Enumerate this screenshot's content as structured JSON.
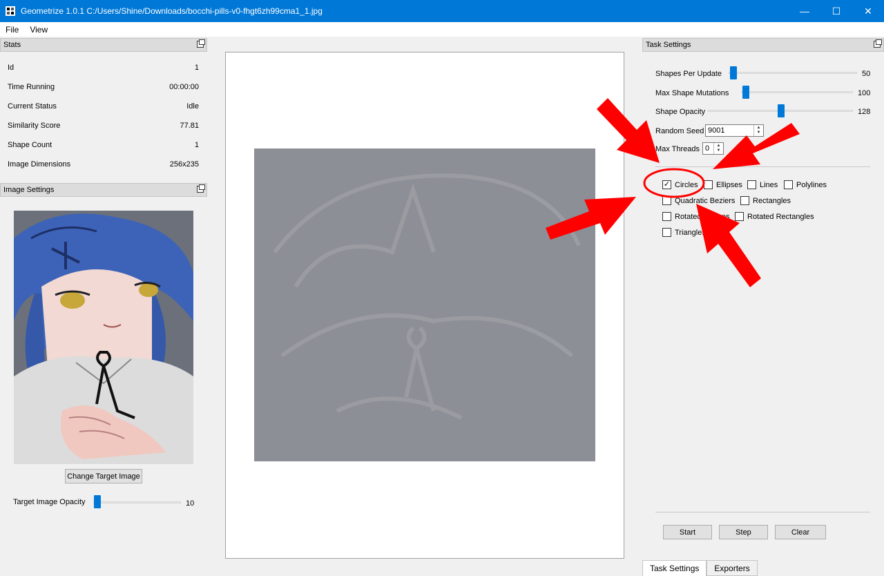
{
  "window": {
    "title": "Geometrize 1.0.1 C:/Users/Shine/Downloads/bocchi-pills-v0-fhgt6zh99cma1_1.jpg",
    "min_glyph": "—",
    "max_glyph": "☐",
    "close_glyph": "✕"
  },
  "menu": {
    "file": "File",
    "view": "View"
  },
  "stats": {
    "header": "Stats",
    "rows": [
      {
        "label": "Id",
        "value": "1"
      },
      {
        "label": "Time Running",
        "value": "00:00:00"
      },
      {
        "label": "Current Status",
        "value": "Idle"
      },
      {
        "label": "Similarity Score",
        "value": "77.81"
      },
      {
        "label": "Shape Count",
        "value": "1"
      },
      {
        "label": "Image Dimensions",
        "value": "256x235"
      }
    ]
  },
  "image_settings": {
    "header": "Image Settings",
    "change_button": "Change Target Image",
    "opacity_label": "Target Image Opacity",
    "opacity_value": "10"
  },
  "task_settings": {
    "header": "Task Settings",
    "sliders": [
      {
        "label": "Shapes Per Update",
        "value": "50"
      },
      {
        "label": "Max Shape Mutations",
        "value": "100"
      },
      {
        "label": "Shape Opacity",
        "value": "128"
      }
    ],
    "random_seed_label": "Random Seed",
    "random_seed_value": "9001",
    "max_threads_label": "Max Threads",
    "max_threads_value": "0",
    "shapes": {
      "circles": "Circles",
      "ellipses": "Ellipses",
      "lines": "Lines",
      "polylines": "Polylines",
      "quadratic_beziers": "Quadratic Beziers",
      "rectangles": "Rectangles",
      "rotated_ellipses": "Rotated Ellipses",
      "rotated_rectangles": "Rotated Rectangles",
      "triangles": "Triangles"
    },
    "checked": [
      "circles"
    ],
    "start": "Start",
    "step": "Step",
    "clear": "Clear"
  },
  "tabs": {
    "task_settings": "Task Settings",
    "exporters": "Exporters"
  },
  "colors": {
    "titlebar": "#0078d7",
    "accent": "#0078d7",
    "annotation": "#ff0000",
    "canvas_shape": "#8d8f96"
  }
}
